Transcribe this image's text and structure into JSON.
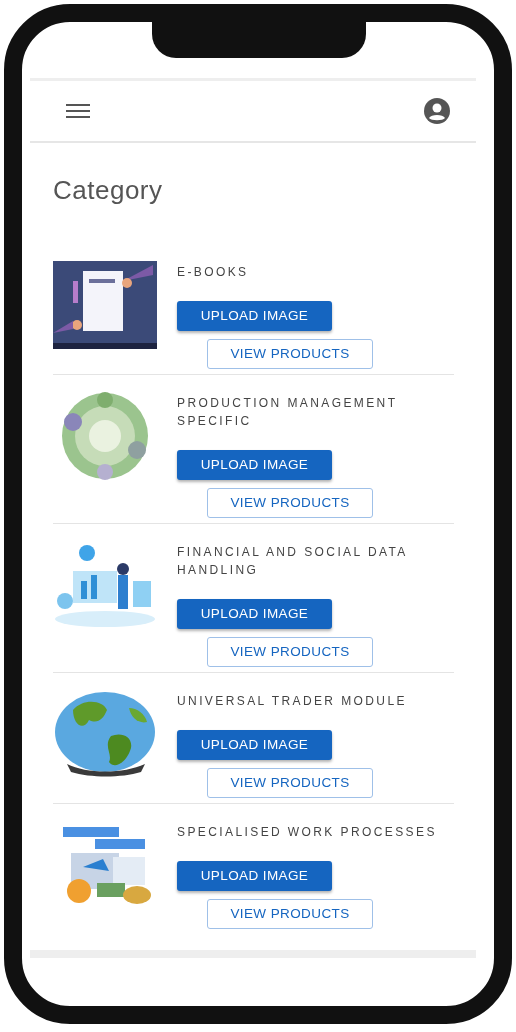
{
  "title": "Category",
  "categories": [
    {
      "name": "E-BOOKS",
      "upload_label": "UPLOAD IMAGE",
      "view_label": "VIEW PRODUCTS"
    },
    {
      "name": "PRODUCTION MANAGEMENT SPECIFIC",
      "upload_label": "UPLOAD IMAGE",
      "view_label": "VIEW PRODUCTS"
    },
    {
      "name": "FINANCIAL AND SOCIAL DATA HANDLING",
      "upload_label": "UPLOAD IMAGE",
      "view_label": "VIEW PRODUCTS"
    },
    {
      "name": "UNIVERSAL TRADER MODULE",
      "upload_label": "UPLOAD IMAGE",
      "view_label": "VIEW PRODUCTS"
    },
    {
      "name": "SPECIALISED WORK PROCESSES",
      "upload_label": "UPLOAD IMAGE",
      "view_label": "VIEW PRODUCTS"
    }
  ]
}
